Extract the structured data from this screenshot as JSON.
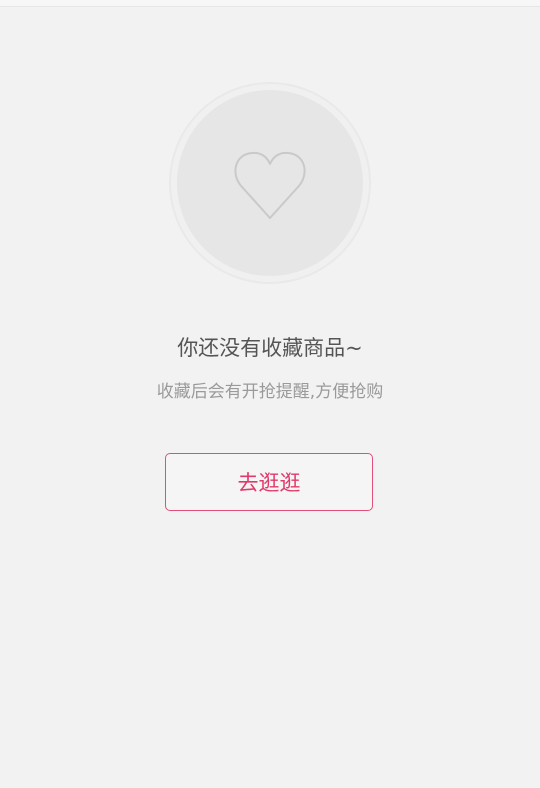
{
  "empty_state": {
    "icon": "heart-outline-icon",
    "title": "你还没有收藏商品~",
    "subtitle": "收藏后会有开抢提醒,方便抢购",
    "button_label": "去逛逛"
  },
  "colors": {
    "background": "#f2f2f2",
    "accent": "#e03a6b",
    "circle_fill": "#e6e6e6",
    "circle_ring": "#ececec",
    "heart_stroke": "#c9c9c9",
    "title_text": "#555555",
    "subtitle_text": "#9a9a9a"
  }
}
